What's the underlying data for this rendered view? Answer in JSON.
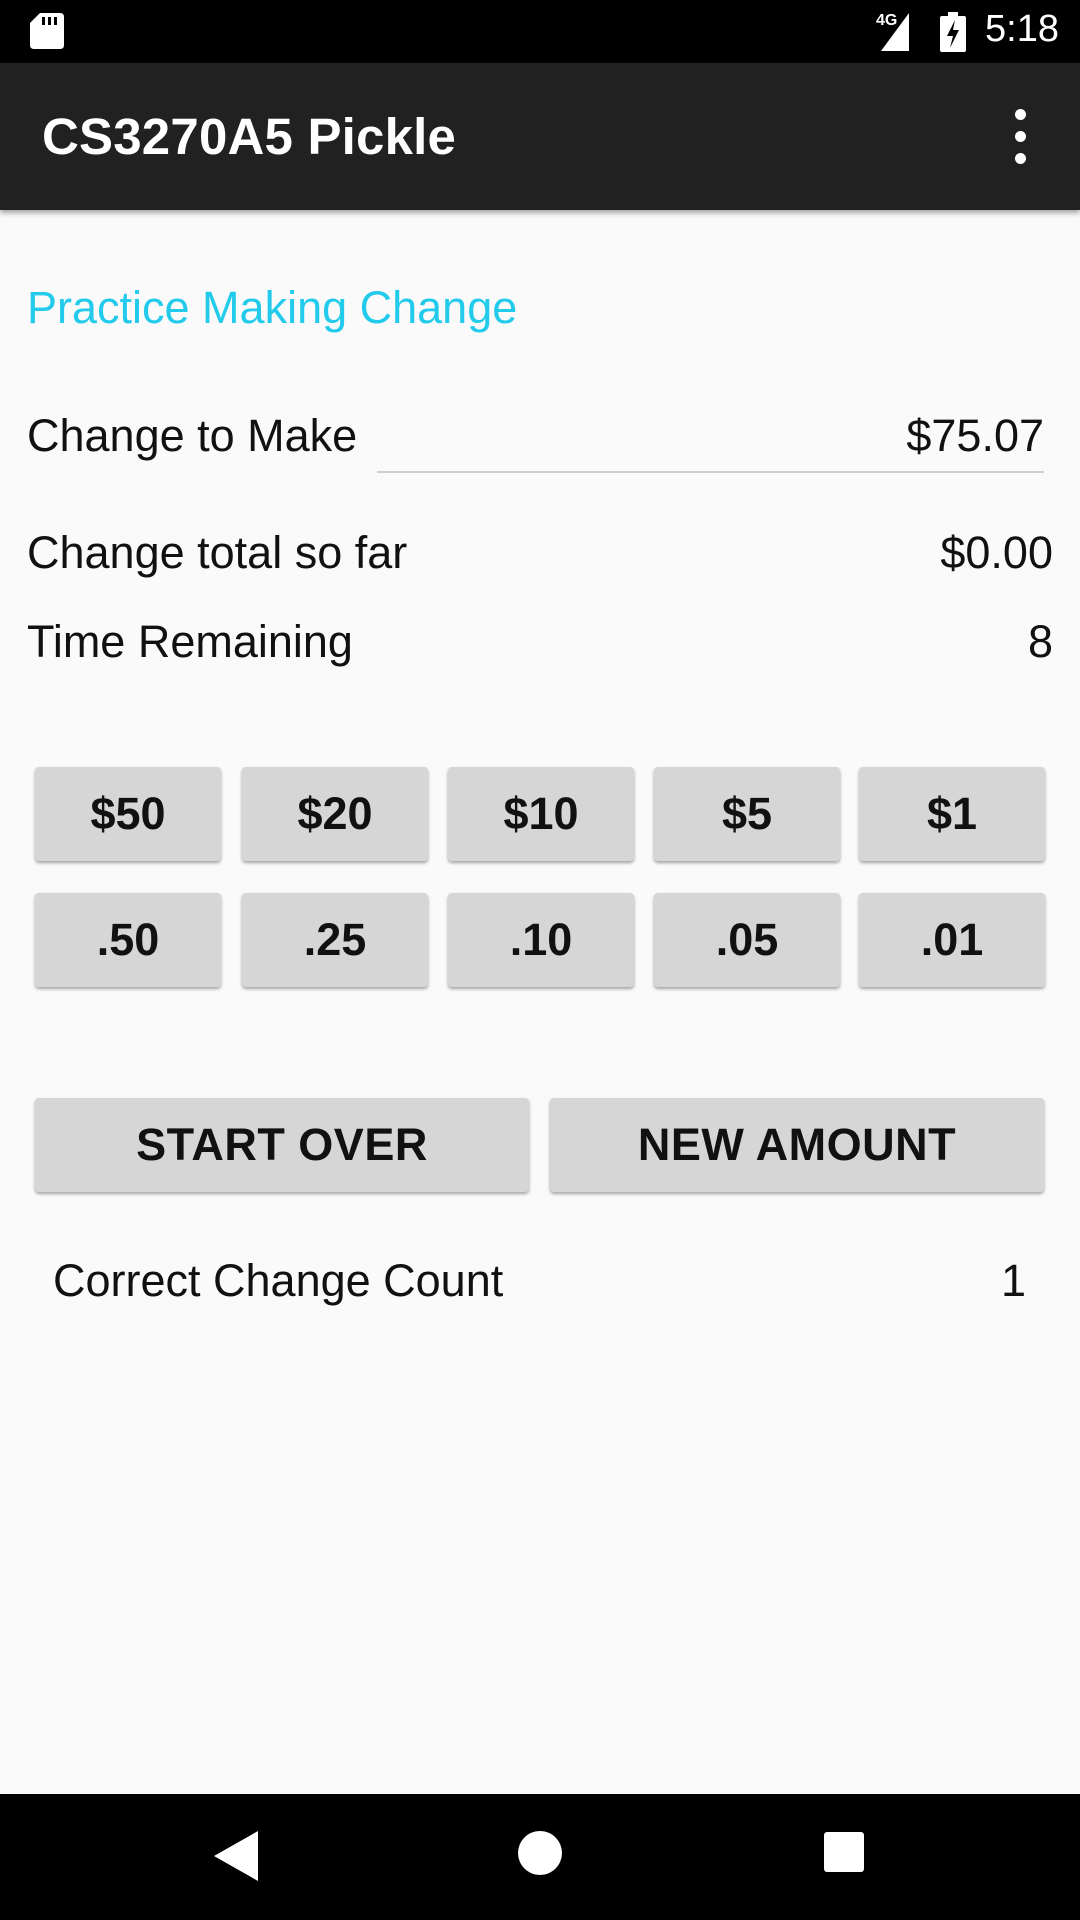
{
  "status_bar": {
    "network": "4G",
    "time": "5:18",
    "icons": [
      "sd-card-icon",
      "signal-icon",
      "battery-charging-icon"
    ]
  },
  "app_bar": {
    "title": "CS3270A5 Pickle",
    "menu_icon": "more-vert-icon"
  },
  "main": {
    "section_title": "Practice Making Change",
    "change_to_make_label": "Change to Make",
    "change_to_make_value": "$75.07",
    "change_total_label": "Change total so far",
    "change_total_value": "$0.00",
    "time_remaining_label": "Time Remaining",
    "time_remaining_value": "8",
    "bills": [
      "$50",
      "$20",
      "$10",
      "$5",
      "$1"
    ],
    "coins": [
      ".50",
      ".25",
      ".10",
      ".05",
      ".01"
    ],
    "start_over_label": "START OVER",
    "new_amount_label": "NEW AMOUNT",
    "correct_count_label": "Correct Change Count",
    "correct_count_value": "1"
  },
  "nav_bar": {
    "icons": [
      "back-icon",
      "home-icon",
      "recents-icon"
    ]
  },
  "colors": {
    "accent": "#22CBEB",
    "app_bar": "#212121",
    "button": "#D6D6D6",
    "background": "#FAFAFA"
  }
}
